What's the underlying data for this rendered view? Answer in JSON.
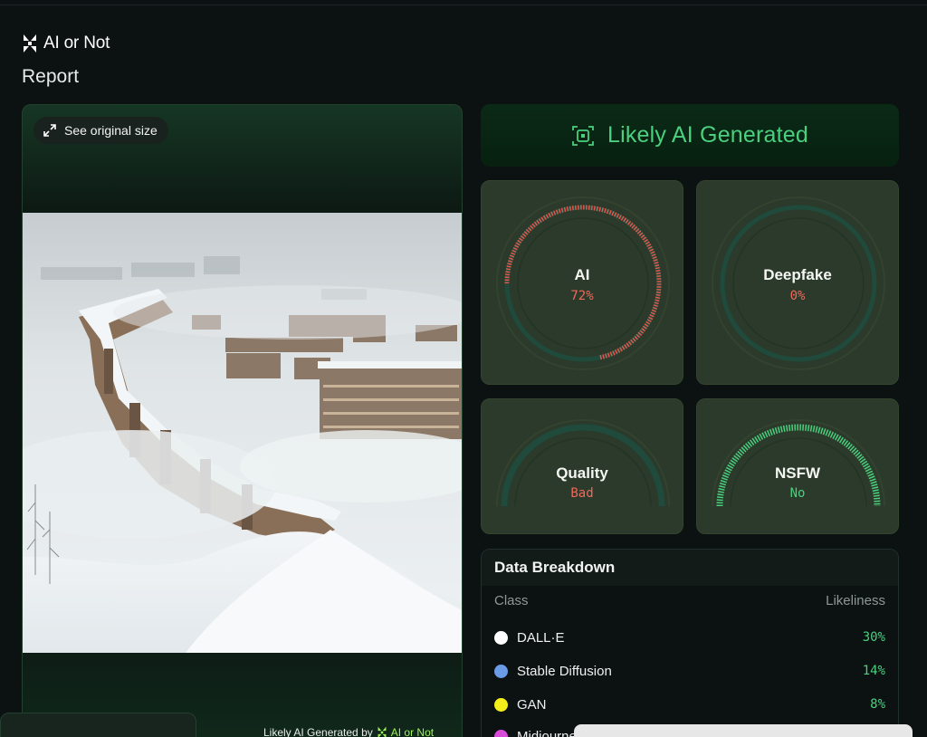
{
  "brand": {
    "name": "AI or Not"
  },
  "page": {
    "title": "Report"
  },
  "image_panel": {
    "see_original_label": "See original size",
    "watermark_prefix": "Likely AI Generated by",
    "watermark_brand": "AI or Not"
  },
  "verdict": {
    "text": "Likely AI Generated",
    "color": "#4ad07e"
  },
  "gauges": [
    {
      "label": "AI",
      "value": "72%",
      "fraction": 0.72,
      "status_color": "#ef6a5d"
    },
    {
      "label": "Deepfake",
      "value": "0%",
      "fraction": 0.0,
      "status_color": "#ef6a5d"
    },
    {
      "label": "Quality",
      "value": "Bad",
      "status_color": "#ef6a5d"
    },
    {
      "label": "NSFW",
      "value": "No",
      "status_color": "#4ad07e"
    }
  ],
  "breakdown": {
    "title": "Data Breakdown",
    "col_class": "Class",
    "col_likeliness": "Likeliness",
    "rows": [
      {
        "name": "DALL·E",
        "value": "30%",
        "color": "#ffffff"
      },
      {
        "name": "Stable Diffusion",
        "value": "14%",
        "color": "#6a9be6"
      },
      {
        "name": "GAN",
        "value": "8%",
        "color": "#f4ee1a"
      },
      {
        "name": "Midjourney",
        "value": "",
        "color": "#d84ad8"
      }
    ]
  }
}
